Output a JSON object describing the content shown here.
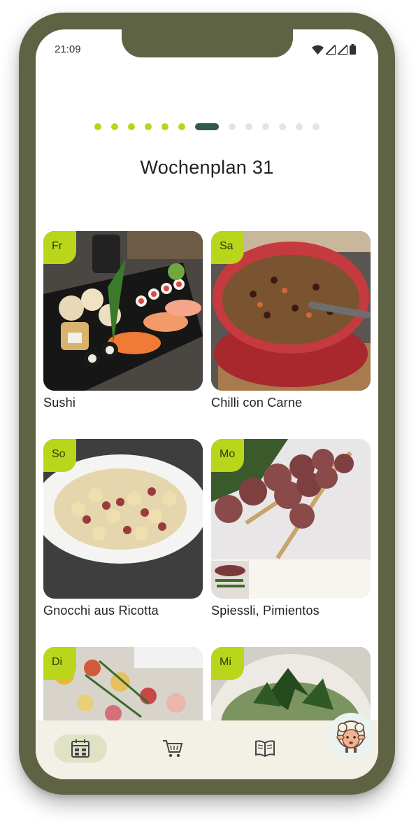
{
  "status_bar": {
    "time": "21:09"
  },
  "pager": {
    "done": 6,
    "active_index": 6,
    "total": 12
  },
  "page_title": "Wochenplan 31",
  "meals": [
    {
      "day": "Fr",
      "name": "Sushi"
    },
    {
      "day": "Sa",
      "name": "Chilli con Carne"
    },
    {
      "day": "So",
      "name": "Gnocchi aus Ricotta"
    },
    {
      "day": "Mo",
      "name": "Spiessli, Pimientos"
    },
    {
      "day": "Di",
      "name": ""
    },
    {
      "day": "Mi",
      "name": ""
    }
  ],
  "nav": {
    "items": [
      {
        "icon": "calendar-icon",
        "active": true
      },
      {
        "icon": "cart-icon",
        "active": false
      },
      {
        "icon": "book-icon",
        "active": false
      },
      {
        "icon": "sheep-mascot-icon",
        "active": false
      }
    ]
  },
  "colors": {
    "frame": "#5e6443",
    "accent": "#b9d61a",
    "active_dot": "#2e5a52",
    "navbar": "#f3f0e5"
  }
}
